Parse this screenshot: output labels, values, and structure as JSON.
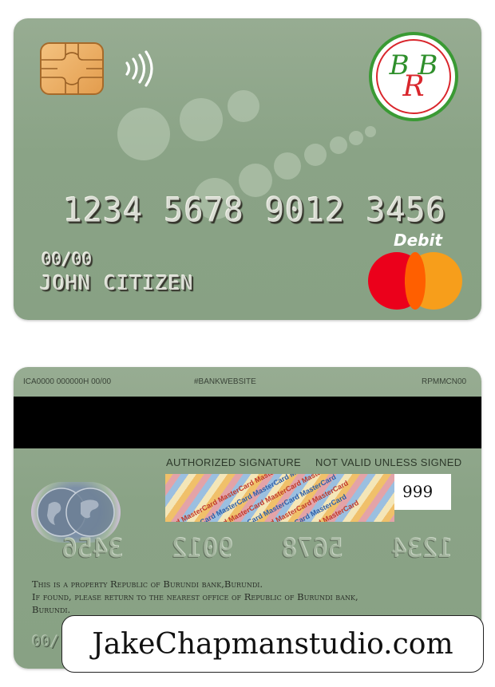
{
  "front": {
    "card_number_groups": [
      "1234",
      "5678",
      "9012",
      "3456"
    ],
    "expiry": "00/00",
    "cardholder": "JOHN CITIZEN",
    "card_type": "Debit",
    "bank_logo": {
      "letters_top": "B  B",
      "letter_mid": "R"
    },
    "network": "mastercard",
    "icons": [
      "chip-icon",
      "contactless-icon",
      "mastercard-logo-icon"
    ]
  },
  "back": {
    "ica_line": "ICA0000 000000H 00/00",
    "website": "#BANKWEBSITE",
    "code": "RPMMCN00",
    "authorized_signature": "AUTHORIZED SIGNATURE",
    "not_valid": "NOT VALID UNLESS SIGNED",
    "cvv": "999",
    "signature_pattern_text": "MasterCard",
    "mirror_number_groups": [
      "1234",
      "5678",
      "9012",
      "3456"
    ],
    "property_line1": "This is a property Republic of Burundi bank,Burundi.",
    "property_line2": "If found, please return to the nearest office of Republic of Burundi bank,",
    "property_line3": "Burundi.",
    "expiry": "00/"
  },
  "watermark": "JakeChapmanstudio.com",
  "colors": {
    "card_green": "#8aa386",
    "logo_green": "#2e8f2b",
    "logo_red": "#d9262c",
    "mc_red": "#eb001b",
    "mc_orange": "#f79e1b"
  }
}
